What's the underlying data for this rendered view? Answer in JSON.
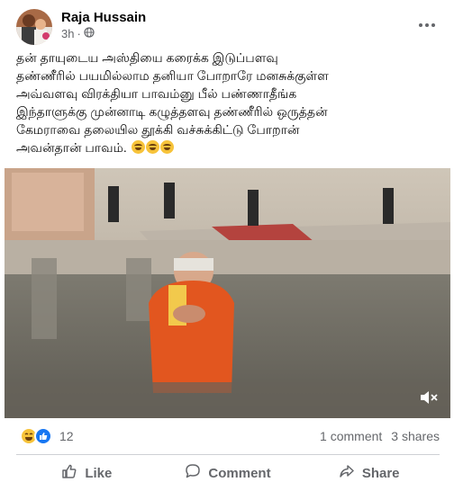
{
  "post": {
    "author": "Raja Hussain",
    "time": "3h",
    "separator": "·",
    "text_lines": [
      "தன் தாயுடைய அஸ்தியை கரைக்க இடுப்பளவு",
      "தண்ணீரில் பயமில்லாம தனியா போறாரே மனசுக்குள்ள",
      "அவ்வளவு விரக்தியா பாவம்னு  பீல் பண்ணாதீங்க",
      "இந்தாளுக்கு முன்னாடி கழுத்தளவு தண்ணீரில் ஒருத்தன்",
      "கேமராவை தலையில தூக்கி வச்சுக்கிட்டு போறான்",
      "அவன்தான் பாவம்."
    ]
  },
  "stats": {
    "reactions_count": "12",
    "comments": "1 comment",
    "shares": "3 shares"
  },
  "actions": {
    "like": "Like",
    "comment": "Comment",
    "share": "Share"
  },
  "icons": {
    "globe": "globe-icon",
    "more": "more-options-icon",
    "volume": "volume-muted-icon",
    "like": "thumbs-up-icon",
    "comment": "speech-bubble-icon",
    "share": "share-arrow-icon"
  },
  "colors": {
    "brand": "#1877f2",
    "secondary_text": "#65676b",
    "haha": "#f7c33a"
  }
}
